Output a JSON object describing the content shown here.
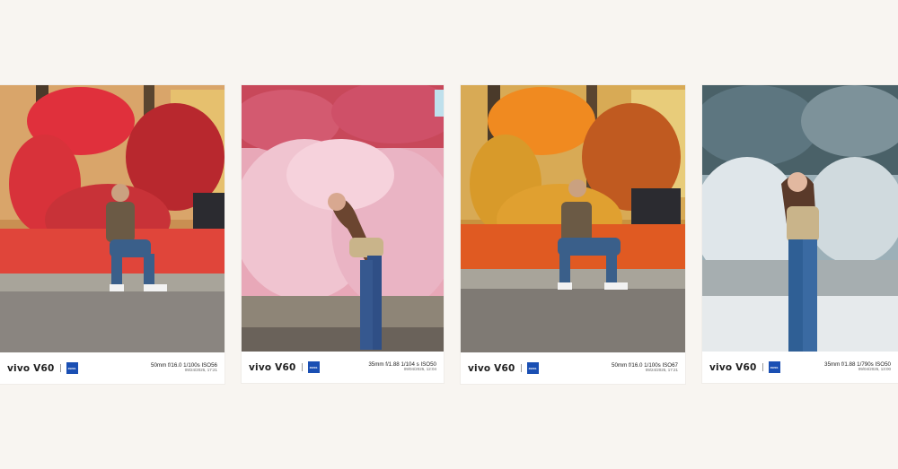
{
  "cards": [
    {
      "brand": "vivo V60",
      "zeiss_logo_text": "ZEISS",
      "specs": "50mm  f/16.0  1/100s  ISO56",
      "date": "09/24/2025, 17:21"
    },
    {
      "brand": "vivo V60",
      "zeiss_logo_text": "ZEISS",
      "specs": "35mm  f/1.88  1/104 s  ISO50",
      "date": "09/04/2025, 12:04"
    },
    {
      "brand": "vivo V60",
      "zeiss_logo_text": "ZEISS",
      "specs": "50mm  f/16.0  1/100s  ISO67",
      "date": "09/24/2025, 17:21"
    },
    {
      "brand": "vivo V60",
      "zeiss_logo_text": "ZEISS",
      "specs": "35mm  f/1.88  1/790s  ISO50",
      "date": "09/04/2025, 13:00"
    }
  ],
  "colors": {
    "background": "#f8f5f1",
    "zeiss_blue": "#1a4fb3"
  }
}
